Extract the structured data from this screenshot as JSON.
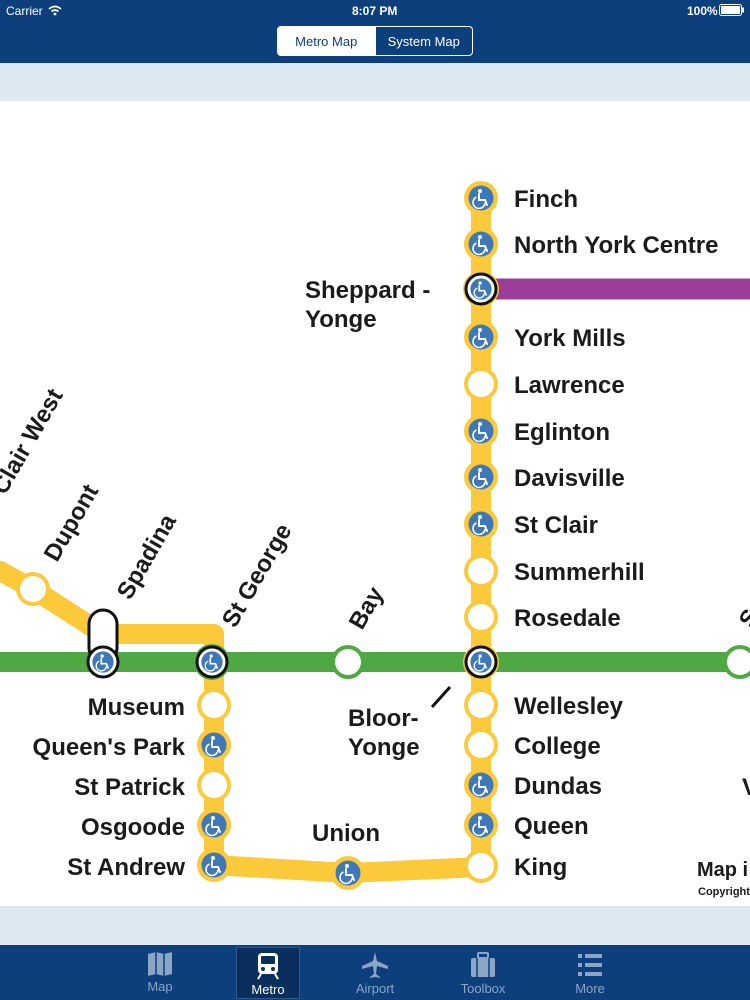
{
  "status_bar": {
    "carrier": "Carrier",
    "time": "8:07 PM",
    "battery": "100%"
  },
  "segmented": {
    "metro_label": "Metro Map",
    "system_label": "System Map",
    "selected": "Metro Map"
  },
  "colors": {
    "header": "#0c3f7b",
    "yonge_line": "#fcc93b",
    "bloor_line": "#4fa844",
    "sheppard_line": "#9c3d98",
    "accessible": "#3f78b8"
  },
  "stations": {
    "finch": "Finch",
    "north_york_centre": "North York Centre",
    "sheppard_yonge_1": "Sheppard -",
    "sheppard_yonge_2": "Yonge",
    "york_mills": "York Mills",
    "lawrence": "Lawrence",
    "eglinton": "Eglinton",
    "davisville": "Davisville",
    "st_clair": "St Clair",
    "summerhill": "Summerhill",
    "rosedale": "Rosedale",
    "wellesley": "Wellesley",
    "college": "College",
    "dundas": "Dundas",
    "queen": "Queen",
    "king": "King",
    "bloor_yonge_1": "Bloor-",
    "bloor_yonge_2": "Yonge",
    "union": "Union",
    "museum": "Museum",
    "queens_park": "Queen's Park",
    "st_patrick": "St Patrick",
    "osgoode": "Osgoode",
    "st_andrew": "St Andrew",
    "st_clair_west": "Clair West",
    "dupont": "Dupont",
    "spadina": "Spadina",
    "st_george": "St George",
    "bay": "Bay",
    "sherbourne_partial": "S",
    "partial_w": "V"
  },
  "map_notes": {
    "map_info": "Map i",
    "copyright": "Copyright"
  },
  "tabs": [
    {
      "label": "Map",
      "icon": "map-icon"
    },
    {
      "label": "Metro",
      "icon": "train-icon"
    },
    {
      "label": "Airport",
      "icon": "airplane-icon"
    },
    {
      "label": "Toolbox",
      "icon": "toolbox-icon"
    },
    {
      "label": "More",
      "icon": "list-icon"
    }
  ],
  "active_tab": "Metro"
}
